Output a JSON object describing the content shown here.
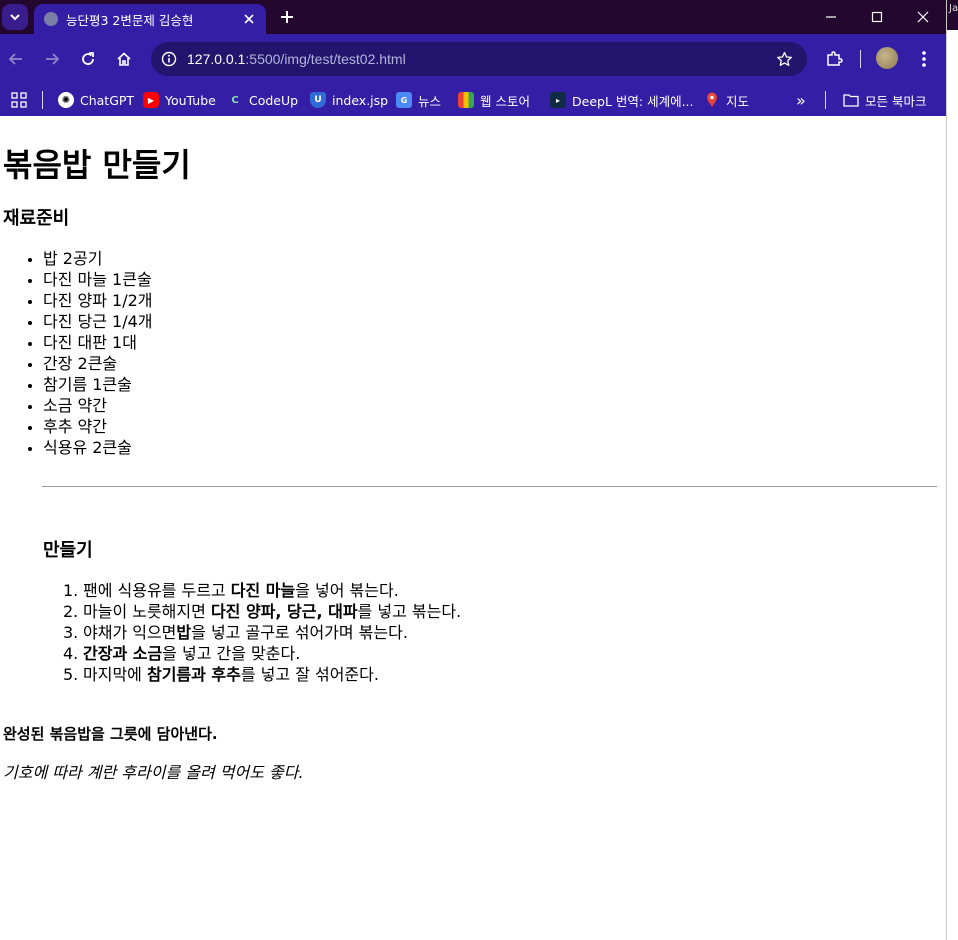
{
  "tab": {
    "title": "능단평3 2변문제 김승현"
  },
  "address_bar": {
    "host": "127.0.0.1",
    "rest": ":5500/img/test/test02.html"
  },
  "side_window": {
    "text": "Ja"
  },
  "bookmarks": {
    "items": [
      {
        "label": "ChatGPT",
        "icon": "chatgpt-icon"
      },
      {
        "label": "YouTube",
        "icon": "youtube-icon"
      },
      {
        "label": "CodeUp",
        "icon": "codeup-icon"
      },
      {
        "label": "index.jsp",
        "icon": "shield-icon"
      },
      {
        "label": "뉴스",
        "icon": "news-icon"
      },
      {
        "label": "웹 스토어",
        "icon": "web-store-icon"
      },
      {
        "label": "DeepL 번역: 세계에...",
        "icon": "deepl-icon"
      },
      {
        "label": "지도",
        "icon": "maps-icon"
      }
    ],
    "overflow_label": "»",
    "all_bookmarks_label": "모든 북마크"
  },
  "page": {
    "title": "볶음밥 만들기",
    "ingredients_heading": "재료준비",
    "ingredients": [
      "밥 2공기",
      "다진 마늘 1큰술",
      "다진 양파 1/2개",
      "다진 당근 1/4개",
      "다진 대판 1대",
      "간장 2큰술",
      "참기름 1큰술",
      "소금 약간",
      "후추 약간",
      "식용유 2큰술"
    ],
    "method_heading": "만들기",
    "steps": [
      {
        "num": "1.",
        "parts": [
          {
            "t": "팬에 식용유를 두르고 "
          },
          {
            "t": "다진 마늘",
            "b": true
          },
          {
            "t": "을 넣어 볶는다."
          }
        ]
      },
      {
        "num": "2.",
        "parts": [
          {
            "t": "마늘이 노릇해지면 "
          },
          {
            "t": "다진 양파, 당근, 대파",
            "b": true
          },
          {
            "t": "를 넣고 볶는다."
          }
        ]
      },
      {
        "num": "3.",
        "parts": [
          {
            "t": "야채가 익으면"
          },
          {
            "t": "밥",
            "b": true
          },
          {
            "t": "을 넣고 골구로 섞어가며 볶는다."
          }
        ]
      },
      {
        "num": "4.",
        "parts": [
          {
            "t": "간장과 소금",
            "b": true
          },
          {
            "t": "을 넣고 간을 맞춘다."
          }
        ]
      },
      {
        "num": "5.",
        "parts": [
          {
            "t": "마지막에 "
          },
          {
            "t": "참기름과 후추",
            "b": true
          },
          {
            "t": "를 넣고 잘 섞어준다."
          }
        ]
      }
    ],
    "done_text": "완성된 볶음밥을 그릇에 담아낸다.",
    "tip_text": "기호에 따라 계란 후라이를 올려 먹어도 좋다."
  },
  "colors": {
    "titlebar": "#23072e",
    "toolbar": "#351ea6",
    "omnibox": "#23156e"
  }
}
